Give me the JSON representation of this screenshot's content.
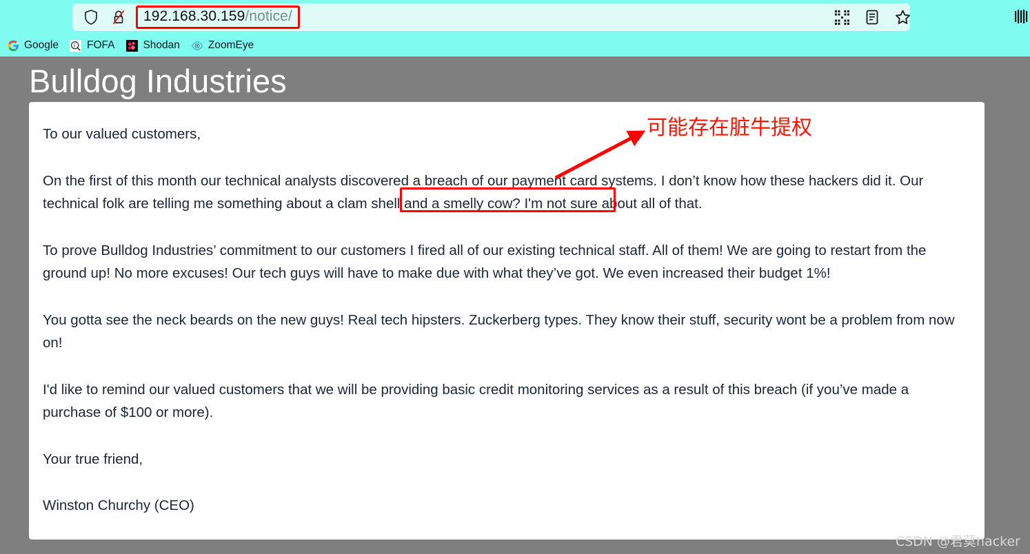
{
  "browser": {
    "url": {
      "host": "192.168.30.159",
      "path": "/notice/"
    },
    "icons": {
      "shield": "shield-icon",
      "lock": "lock-slash-icon",
      "qr": "qr-code-icon",
      "reader": "reader-mode-icon",
      "bookmark": "star-icon",
      "edge": "partial-edge-icon"
    },
    "bookmarks": [
      {
        "label": "Google",
        "icon": "google-icon"
      },
      {
        "label": "FOFA",
        "icon": "fofa-icon"
      },
      {
        "label": "Shodan",
        "icon": "shodan-icon"
      },
      {
        "label": "ZoomEye",
        "icon": "zoomeye-icon"
      }
    ]
  },
  "page": {
    "title": "Bulldog Industries",
    "paragraphs": [
      "To our valued customers,",
      "On the first of this month our technical analysts discovered a breach of our payment card systems. I don’t know how these hackers did it. Our technical folk are telling me something about a clam shell and a smelly cow? I'm not sure about all of that.",
      "To prove Bulldog Industries’ commitment to our customers I fired all of our existing technical staff. All of them! We are going to restart from the ground up! No more excuses! Our tech guys will have to make due with what they’ve got. We even increased their budget 1%!",
      "You gotta see the neck beards on the new guys! Real tech hipsters. Zuckerberg types. They know their stuff, security wont be a problem from now on!",
      "I'd like to remind our valued customers that we will be providing basic credit monitoring services as a result of this breach (if you’ve made a purchase of $100 or more).",
      "Your true friend,",
      "Winston Churchy (CEO)"
    ]
  },
  "annotations": {
    "note_text": "可能存在脏牛提权",
    "highlight_phrase": "a clam shell and a smelly cow?",
    "arrow": "red-arrow",
    "color": "#FF0000"
  },
  "watermark": {
    "text": "CSDN @君莫hacker"
  },
  "colors": {
    "chrome_background": "#7FFCEF",
    "urlbar_background": "#DFFBF7",
    "page_background": "#7f7f7f",
    "card_background": "#ffffff",
    "annotation_red": "#FF0000",
    "body_text": "#1b2533"
  }
}
